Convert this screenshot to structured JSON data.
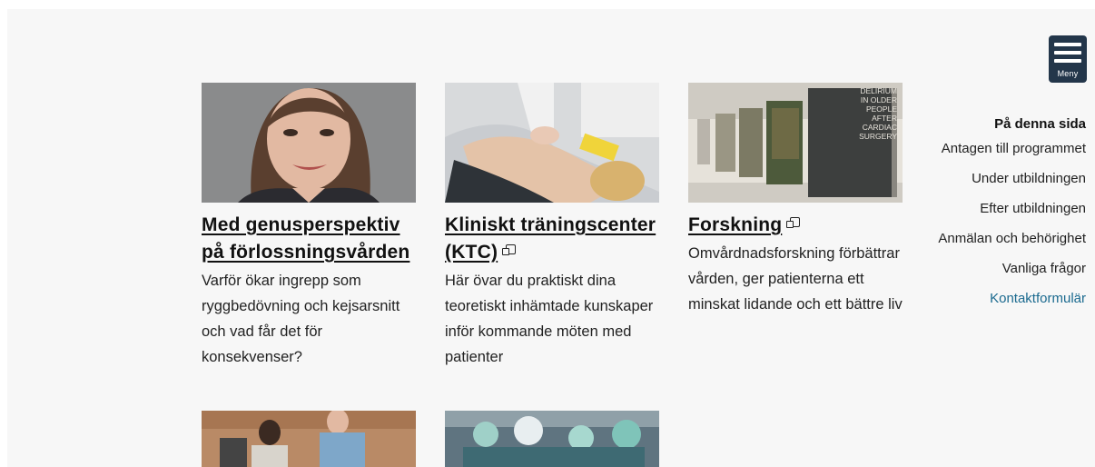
{
  "menu": {
    "label": "Meny"
  },
  "cards": [
    {
      "title": "Med genusperspektiv på förlossningsvården",
      "external": false,
      "text": "Varför ökar ingrepp som ryggbedövning och kejsarsnitt och vad får det för konsekvenser?"
    },
    {
      "title": "Kliniskt träningscenter (KTC)",
      "external": true,
      "text": "Här övar du praktiskt dina teoretiskt inhämtade kunskaper inför kommande möten med patienter"
    },
    {
      "title": "Forskning",
      "external": true,
      "text": "Omvårdnadsforskning förbättrar vården, ger patienterna ett minskat lidande och ett bättre liv"
    }
  ],
  "book_cover": {
    "title_lines": [
      "DELIRIUM",
      "IN OLDER",
      "PEOPLE",
      "AFTER",
      "CARDIAC",
      "SURGERY"
    ]
  },
  "on_this_page": {
    "heading": "På denna sida",
    "links": [
      "Antagen till programmet",
      "Under utbildningen",
      "Efter utbildningen",
      "Anmälan och behörighet",
      "Vanliga frågor",
      "Kontaktformulär"
    ]
  },
  "icons": [
    "menu-icon",
    "external-link-icon"
  ]
}
